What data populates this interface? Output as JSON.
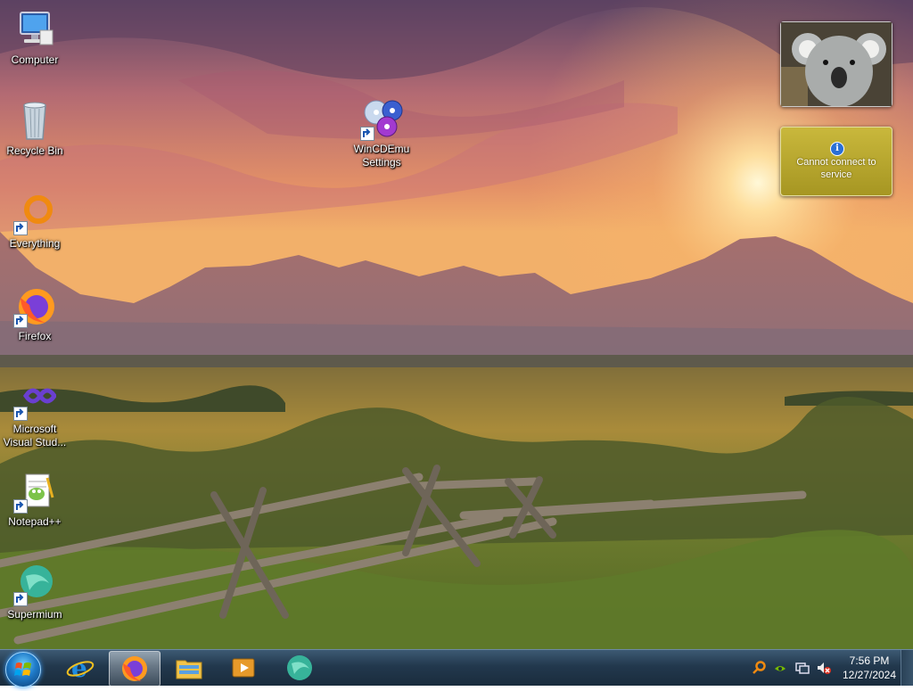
{
  "desktop": {
    "icons": [
      {
        "label": "Computer"
      },
      {
        "label": "Recycle Bin"
      },
      {
        "label": "Everything"
      },
      {
        "label": "Firefox"
      },
      {
        "label": "Microsoft Visual Stud..."
      },
      {
        "label": "Notepad++"
      },
      {
        "label": "Supermium"
      },
      {
        "label": "WinCDEmu Settings"
      }
    ]
  },
  "gadgets": {
    "weather": {
      "message": "Cannot connect to service",
      "icon": "info-icon"
    },
    "slideshow": {
      "icon": "koala-photo"
    }
  },
  "taskbar": {
    "start_icon": "windows-logo",
    "pinned": [
      {
        "name": "Internet Explorer",
        "icon": "ie-icon"
      },
      {
        "name": "Firefox",
        "icon": "firefox-icon",
        "active": true
      },
      {
        "name": "File Explorer",
        "icon": "folder-icon"
      },
      {
        "name": "Media Player",
        "icon": "media-player-icon"
      },
      {
        "name": "Supermium",
        "icon": "supermium-icon"
      }
    ],
    "tray": {
      "icons": [
        "search-icon",
        "nvidia-icon",
        "network-icon",
        "volume-muted-icon"
      ],
      "time": "7:56 PM",
      "date": "12/27/2024"
    }
  },
  "colors": {
    "taskbar": "#22384d",
    "weather_gadget": "#b8a82e",
    "sky_top": "#6a4a6e",
    "sun": "#ffe9a0"
  }
}
